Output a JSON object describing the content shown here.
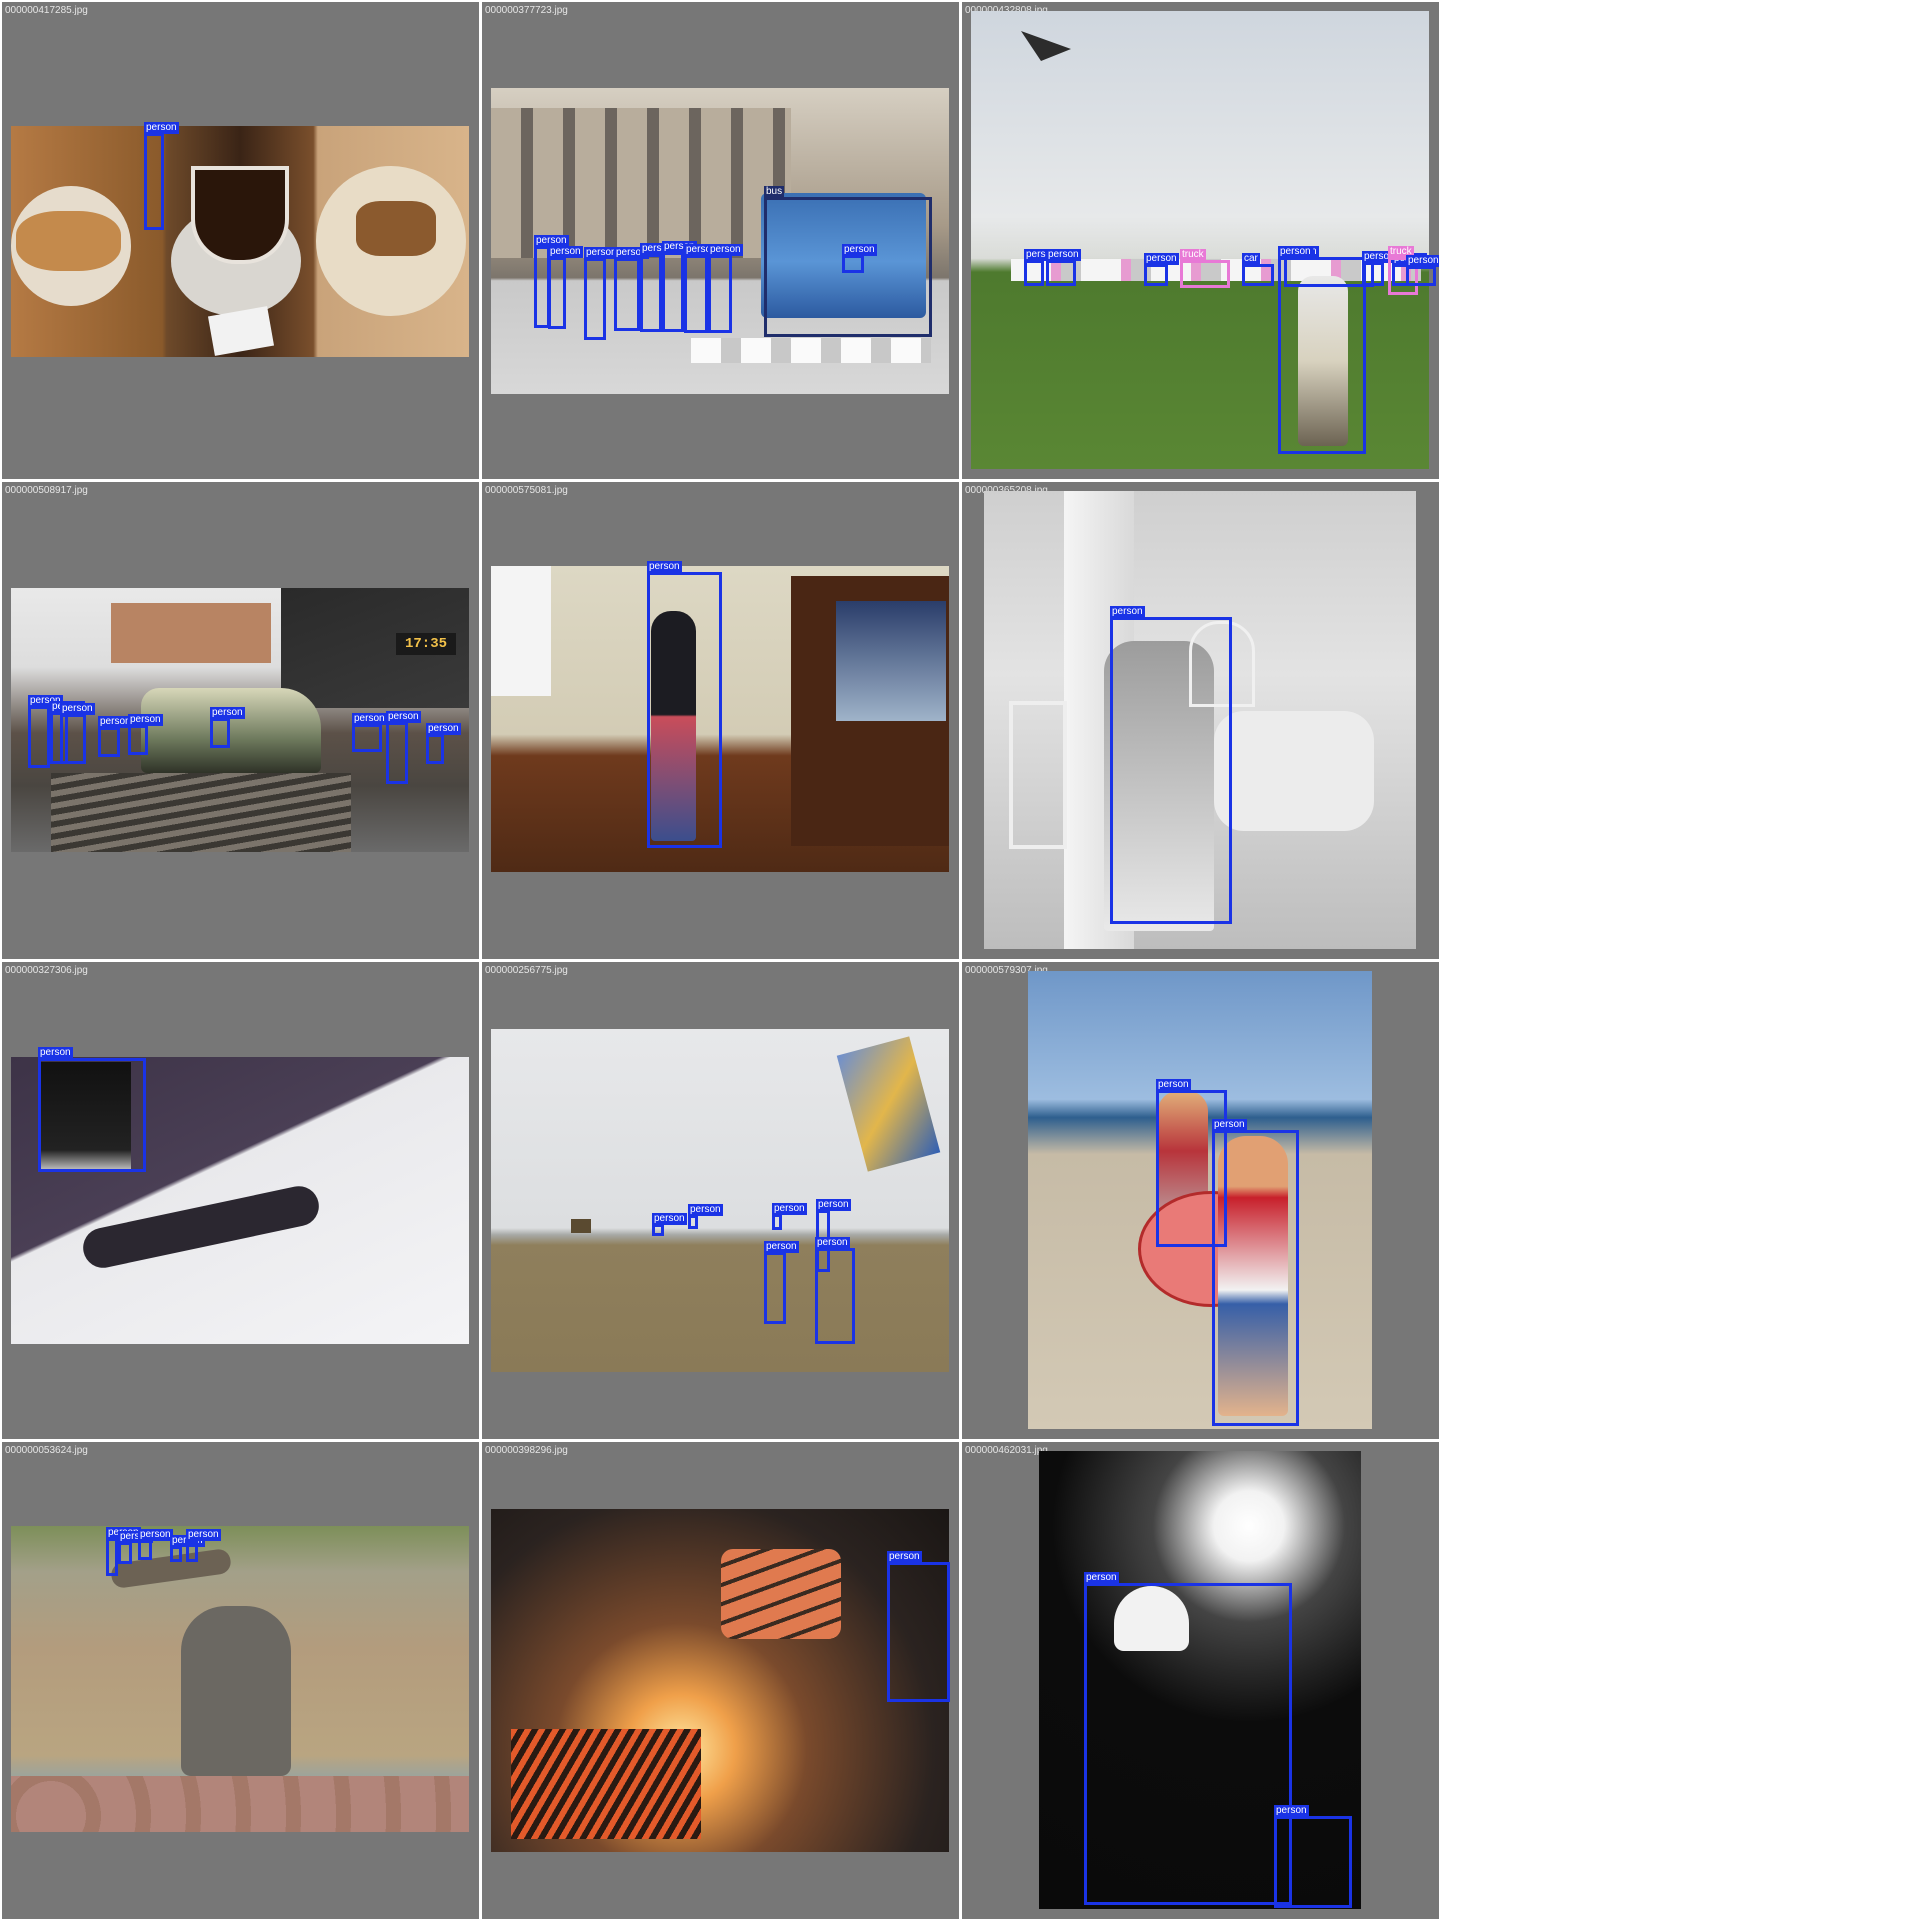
{
  "tiles": [
    {
      "file": "000000417285.jpg",
      "label": "person"
    },
    {
      "file": "000000377723.jpg",
      "labels": [
        "person",
        "person",
        "person",
        "person",
        "person",
        "person",
        "person",
        "person",
        "bus",
        "person"
      ]
    },
    {
      "file": "000000432808.jpg",
      "labels": [
        "person",
        "person",
        "person",
        "person",
        "person",
        "truck",
        "car",
        "person",
        "person",
        "truck",
        "person"
      ]
    },
    {
      "file": "000000508917.jpg",
      "labels": [
        "person",
        "person",
        "person",
        "person",
        "person",
        "person",
        "person",
        "person",
        "person"
      ]
    },
    {
      "file": "000000575081.jpg",
      "label": "person"
    },
    {
      "file": "000000365208.jpg",
      "label": "person"
    },
    {
      "file": "000000327306.jpg",
      "label": "person"
    },
    {
      "file": "000000256775.jpg",
      "labels": [
        "person",
        "person",
        "person",
        "person",
        "person",
        "person"
      ]
    },
    {
      "file": "000000579307.jpg",
      "labels": [
        "person",
        "person"
      ]
    },
    {
      "file": "000000053624.jpg",
      "labels": [
        "person",
        "person",
        "person",
        "person",
        "person"
      ]
    },
    {
      "file": "000000398296.jpg",
      "label": "person"
    },
    {
      "file": "000000462031.jpg",
      "labels": [
        "person",
        "person"
      ]
    }
  ],
  "clock_text": "17:35",
  "colors": {
    "person_box": "#1a33e6",
    "truck_box": "#e879d6",
    "tile_bg": "#777777"
  }
}
